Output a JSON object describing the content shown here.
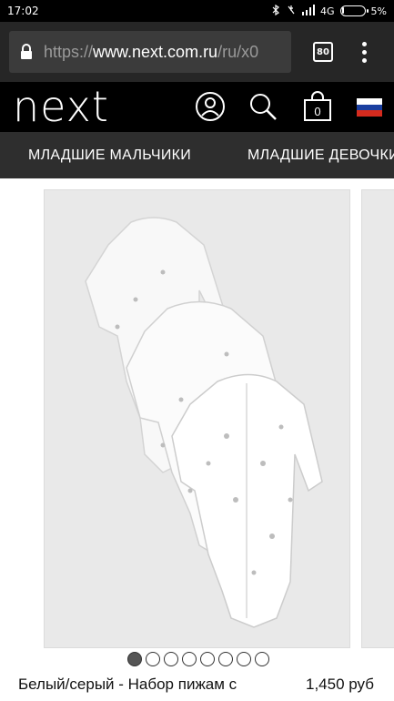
{
  "status_bar": {
    "time": "17:02",
    "network": "4G",
    "battery": "5%",
    "battery_level": 0.05
  },
  "browser": {
    "url_scheme": "https://",
    "url_host": "www.next.com.ru",
    "url_path": "/ru/x0",
    "tab_count": "80"
  },
  "site": {
    "logo": "next",
    "bag_count": "0",
    "flag_colors": [
      "#ffffff",
      "#1a3fa0",
      "#d52b1e"
    ]
  },
  "nav": {
    "items": [
      {
        "label": "МЛАДШИЕ МАЛЬЧИКИ"
      },
      {
        "label": "МЛАДШИЕ ДЕВОЧКИ"
      }
    ]
  },
  "product": {
    "name": "Белый/серый - Набор пижам с",
    "price": "1,450 руб",
    "image_count": 8,
    "active_image": 1
  }
}
